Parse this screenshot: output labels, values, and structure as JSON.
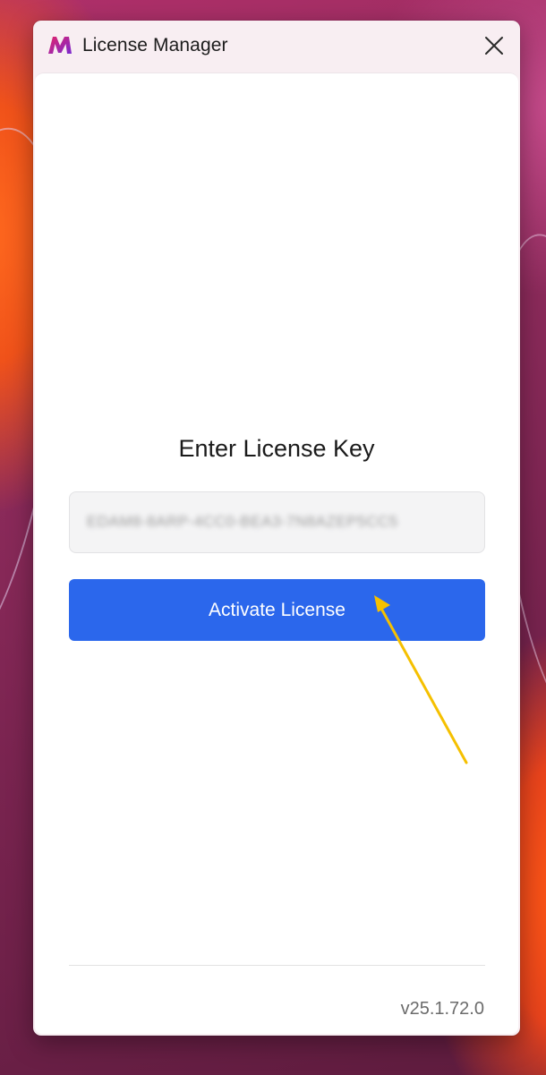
{
  "window": {
    "title": "License Manager",
    "close_icon": "close-icon",
    "logo_icon": "app-logo-icon"
  },
  "main": {
    "heading": "Enter License Key",
    "license_input_value": "EDAM8-8ARP-4CC0-BEA3-7N8AZEP5CC5",
    "activate_label": "Activate License",
    "accent_color": "#2b67ec"
  },
  "footer": {
    "version": "v25.1.72.0"
  },
  "annotation": {
    "arrow_icon": "pointer-arrow-icon",
    "arrow_color": "#f5c000"
  }
}
